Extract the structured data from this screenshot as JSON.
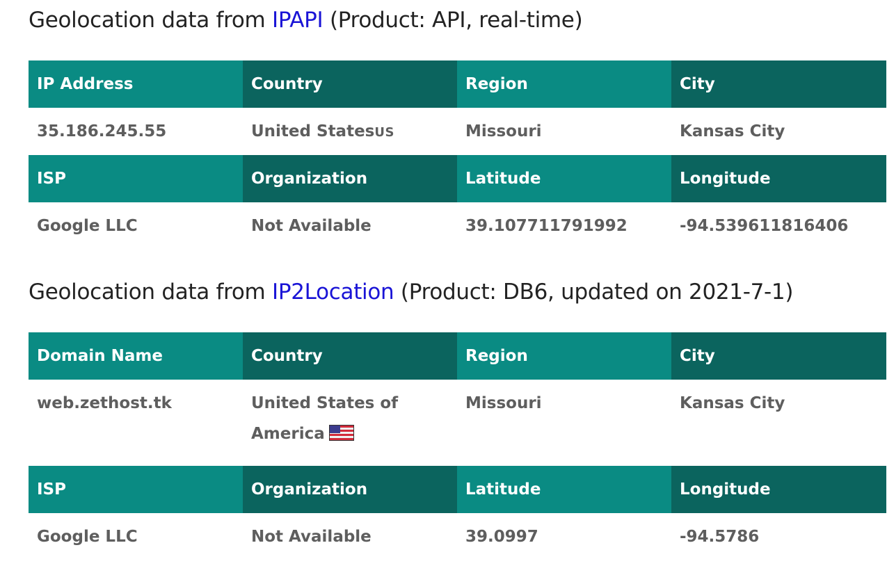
{
  "section1": {
    "title_prefix": "Geolocation data from ",
    "provider": "IPAPI",
    "title_suffix": " (Product: API, real-time)",
    "row1_headers": [
      "IP Address",
      "Country",
      "Region",
      "City"
    ],
    "row1_values": {
      "ip": "35.186.245.55",
      "country": "United States",
      "country_code": "US",
      "region": "Missouri",
      "city": "Kansas City"
    },
    "row2_headers": [
      "ISP",
      "Organization",
      "Latitude",
      "Longitude"
    ],
    "row2_values": [
      "Google LLC",
      "Not Available",
      "39.107711791992",
      "-94.539611816406"
    ]
  },
  "section2": {
    "title_prefix": "Geolocation data from ",
    "provider": "IP2Location",
    "title_suffix": " (Product: DB6, updated on 2021-7-1)",
    "row1_headers": [
      "Domain Name",
      "Country",
      "Region",
      "City"
    ],
    "row1_values": {
      "domain": "web.zethost.tk",
      "country": "United States of America",
      "region": "Missouri",
      "city": "Kansas City"
    },
    "row2_headers": [
      "ISP",
      "Organization",
      "Latitude",
      "Longitude"
    ],
    "row2_values": [
      "Google LLC",
      "Not Available",
      "39.0997",
      "-94.5786"
    ]
  },
  "colors": {
    "header_light": "#0a8b83",
    "header_dark": "#0b645e",
    "link": "#1a14d6",
    "value_text": "#5e5e5e"
  }
}
